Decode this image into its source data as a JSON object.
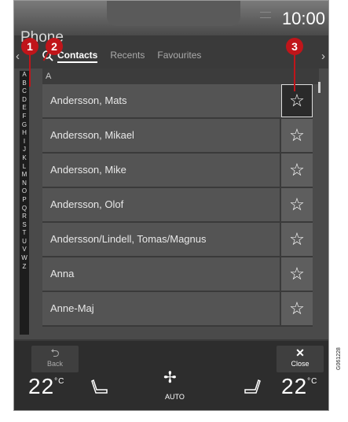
{
  "status": {
    "time": "10:00"
  },
  "app": {
    "title": "Phone"
  },
  "tabs": [
    {
      "label": "Contacts",
      "active": true
    },
    {
      "label": "Recents",
      "active": false
    },
    {
      "label": "Favourites",
      "active": false
    }
  ],
  "section_header": "A",
  "alphabet": [
    "A",
    "B",
    "C",
    "D",
    "E",
    "F",
    "G",
    "H",
    "I",
    "J",
    "K",
    "L",
    "M",
    "N",
    "O",
    "P",
    "Q",
    "R",
    "S",
    "T",
    "U",
    "V",
    "W",
    "Z"
  ],
  "contacts": [
    {
      "name": "Andersson, Mats",
      "favourite_selected": true
    },
    {
      "name": "Andersson, Mikael",
      "favourite_selected": false
    },
    {
      "name": "Andersson, Mike",
      "favourite_selected": false
    },
    {
      "name": "Andersson, Olof",
      "favourite_selected": false
    },
    {
      "name": "Andersson/Lindell, Tomas/Magnus",
      "favourite_selected": false
    },
    {
      "name": "Anna",
      "favourite_selected": false
    },
    {
      "name": "Anne-Maj",
      "favourite_selected": false
    }
  ],
  "bottom": {
    "back_label": "Back",
    "close_label": "Close"
  },
  "climate": {
    "left_temp": "22",
    "right_temp": "22",
    "unit": "°C",
    "auto_label": "AUTO"
  },
  "callouts": [
    "1",
    "2",
    "3"
  ],
  "reference_code": "G061228",
  "colors": {
    "callout": "#c0151a",
    "screen_bg": "#3a3a3a"
  }
}
